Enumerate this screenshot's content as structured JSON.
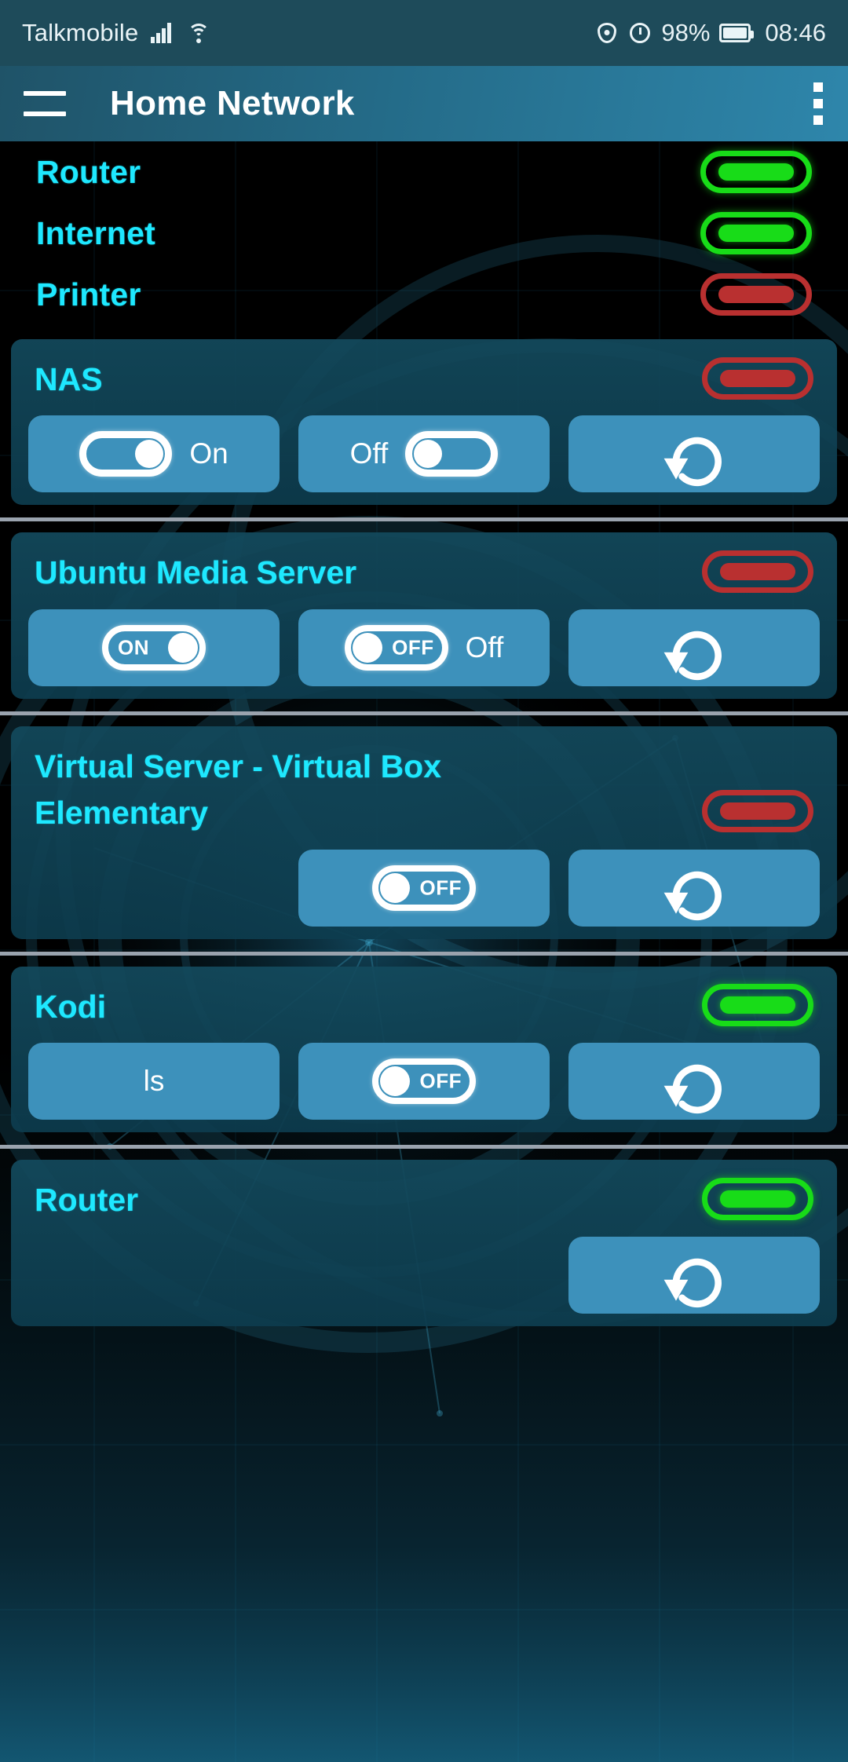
{
  "statusbar": {
    "carrier": "Talkmobile",
    "signal_icon": "signal-bars-icon",
    "wifi_icon": "wifi-icon",
    "eye_icon": "eye-icon",
    "alarm_icon": "alarm-clock-icon",
    "battery_percent": "98%",
    "battery_icon": "battery-icon",
    "clock": "08:46"
  },
  "appbar": {
    "menu_icon": "hamburger-menu-icon",
    "title": "Home Network",
    "overflow_icon": "more-options-icon"
  },
  "colors": {
    "accent_cyan": "#1ee8ff",
    "status_online": "#18dc18",
    "status_offline": "#b93030",
    "button_blue": "#3d91bb",
    "card_teal": "#134a5d",
    "appbar_start": "#1f5368",
    "appbar_end": "#2e86ab"
  },
  "status_rows": [
    {
      "name": "Router",
      "status": "online",
      "status_name": "status-pill-online"
    },
    {
      "name": "Internet",
      "status": "online",
      "status_name": "status-pill-online"
    },
    {
      "name": "Printer",
      "status": "offline",
      "status_name": "status-pill-offline"
    }
  ],
  "devices": [
    {
      "id": "nas",
      "title": "NAS",
      "title2": "",
      "status": "offline",
      "buttons": [
        {
          "type": "toggle-label",
          "toggle": "on",
          "toggle_text": "",
          "label": "On",
          "order": "switch-first",
          "name": "nas-on-button"
        },
        {
          "type": "toggle-label",
          "toggle": "off",
          "toggle_text": "",
          "label": "Off",
          "order": "label-first",
          "name": "nas-off-button"
        },
        {
          "type": "refresh",
          "icon": "refresh-icon",
          "label": "",
          "name": "nas-refresh-button"
        }
      ]
    },
    {
      "id": "ubuntu-media-server",
      "title": "Ubuntu Media Server",
      "title2": "",
      "status": "offline",
      "buttons": [
        {
          "type": "toggle-text",
          "toggle": "on",
          "toggle_text": "ON",
          "label": "",
          "order": "switch-first",
          "name": "ubuntu-on-button"
        },
        {
          "type": "toggle-text",
          "toggle": "off",
          "toggle_text": "OFF",
          "label": "Off",
          "order": "switch-first",
          "name": "ubuntu-off-button"
        },
        {
          "type": "refresh",
          "icon": "refresh-icon",
          "label": "",
          "name": "ubuntu-refresh-button"
        }
      ]
    },
    {
      "id": "virtual-server-virtual-box",
      "title": "Virtual Server - Virtual Box",
      "title2": "Elementary",
      "status": "offline",
      "buttons": [
        {
          "type": "empty",
          "name": "virtualbox-empty-slot"
        },
        {
          "type": "toggle-text",
          "toggle": "off",
          "toggle_text": "OFF",
          "label": "",
          "order": "switch-first",
          "name": "virtualbox-off-button"
        },
        {
          "type": "refresh",
          "icon": "refresh-icon",
          "label": "",
          "name": "virtualbox-refresh-button"
        }
      ]
    },
    {
      "id": "kodi",
      "title": "Kodi",
      "title2": "",
      "status": "online",
      "buttons": [
        {
          "type": "text-only",
          "label": "ls",
          "name": "kodi-ls-button"
        },
        {
          "type": "toggle-text",
          "toggle": "off",
          "toggle_text": "OFF",
          "label": "",
          "order": "switch-first",
          "name": "kodi-off-button"
        },
        {
          "type": "refresh",
          "icon": "refresh-icon",
          "label": "",
          "name": "kodi-refresh-button"
        }
      ]
    },
    {
      "id": "router-device",
      "title": "Router",
      "title2": "",
      "status": "online",
      "buttons": [
        {
          "type": "empty",
          "name": "router-empty-slot-1"
        },
        {
          "type": "empty",
          "name": "router-empty-slot-2"
        },
        {
          "type": "refresh",
          "icon": "refresh-icon",
          "label": "",
          "name": "router-refresh-button"
        }
      ]
    }
  ]
}
